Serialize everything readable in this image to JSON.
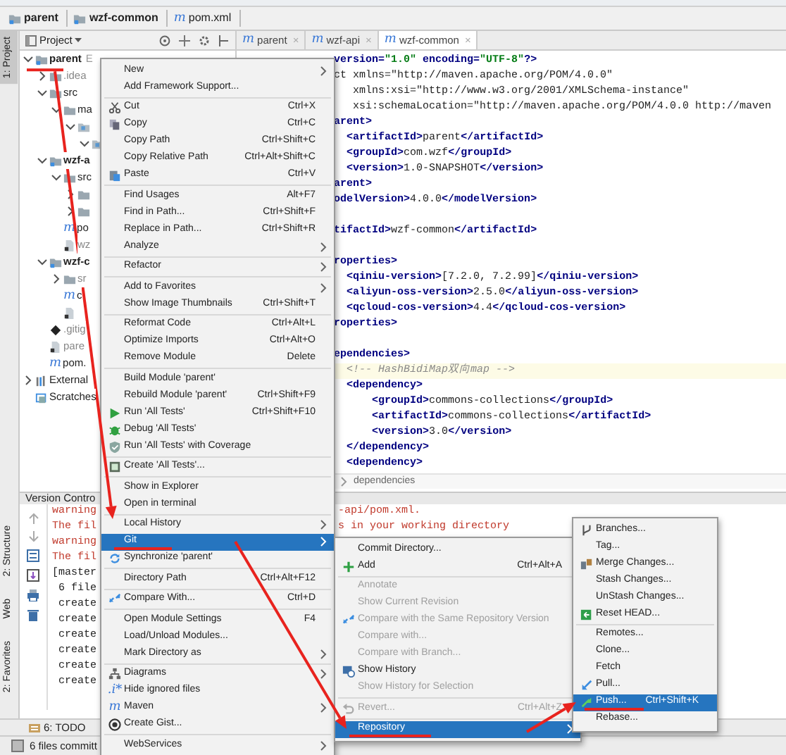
{
  "breadcrumb": [
    {
      "label": "parent",
      "kind": "module"
    },
    {
      "label": "wzf-common",
      "kind": "module"
    },
    {
      "label": "pom.xml",
      "glyph": "m"
    }
  ],
  "tool_strip": [
    {
      "label": "1: Project",
      "selected": true
    },
    {
      "label": "2: Structure",
      "selected": false
    },
    {
      "label": "Web",
      "selected": false
    },
    {
      "label": "2: Favorites",
      "selected": false
    }
  ],
  "project_panel": {
    "title": "Project",
    "tree": [
      {
        "label": "parent",
        "hint": "E",
        "kind": "module",
        "bold": true,
        "expanded": true,
        "children": [
          {
            "label": ".idea",
            "kind": "folder",
            "dim": true,
            "expanded": false
          },
          {
            "label": "src",
            "kind": "folder",
            "expanded": true,
            "children": [
              {
                "label": "ma",
                "kind": "folder",
                "expanded": true,
                "children": [
                  {
                    "kind": "package",
                    "expanded": true,
                    "children": [
                      {
                        "kind": "package",
                        "expanded": true
                      }
                    ]
                  }
                ]
              }
            ]
          },
          {
            "label": "wzf-a",
            "kind": "module",
            "bold": true,
            "expanded": true,
            "children": [
              {
                "label": "src",
                "kind": "folder",
                "expanded": true,
                "children": [
                  {
                    "kind": "folder",
                    "expanded": false
                  },
                  {
                    "kind": "folder",
                    "expanded": false
                  }
                ]
              },
              {
                "label": "po",
                "glyph": "m"
              },
              {
                "label": "wz",
                "kind": "iml",
                "dim": true
              }
            ]
          },
          {
            "label": "wzf-c",
            "kind": "module",
            "bold": true,
            "expanded": true,
            "children": [
              {
                "label": "sr",
                "kind": "folder",
                "dim": true,
                "expanded": false
              },
              {
                "label": "c",
                "glyph": "m"
              },
              {
                "kind": "iml"
              }
            ]
          },
          {
            "label": ".gitig",
            "kind": "gitignore",
            "dim": true
          },
          {
            "label": "pare",
            "kind": "iml",
            "dim": true
          },
          {
            "label": "pom.",
            "glyph": "m"
          }
        ]
      },
      {
        "label": "External",
        "kind": "library",
        "expanded": false
      },
      {
        "label": "Scratches",
        "kind": "scratch"
      }
    ]
  },
  "editor": {
    "tabs": [
      {
        "label": "parent",
        "glyph": "m",
        "close": "×",
        "selected": false
      },
      {
        "label": "wzf-api",
        "glyph": "m",
        "close": "×",
        "selected": false
      },
      {
        "label": "wzf-common",
        "glyph": "m",
        "close": "×",
        "selected": true
      }
    ],
    "lines": [
      {
        "kind": "code",
        "text": "version=\"1.0\" encoding=\"UTF-8\"?>"
      },
      {
        "kind": "code",
        "text": "ct xmlns=\"http://maven.apache.org/POM/4.0.0\""
      },
      {
        "kind": "code",
        "text": "   xmlns:xsi=\"http://www.w3.org/2001/XMLSchema-instance\""
      },
      {
        "kind": "code",
        "text": "   xsi:schemaLocation=\"http://maven.apache.org/POM/4.0.0 http://maven"
      },
      {
        "kind": "code",
        "text": "arent>"
      },
      {
        "kind": "code",
        "text": "  <artifactId>parent</artifactId>"
      },
      {
        "kind": "code",
        "text": "  <groupId>com.wzf</groupId>"
      },
      {
        "kind": "code",
        "text": "  <version>1.0-SNAPSHOT</version>"
      },
      {
        "kind": "code",
        "text": "arent>"
      },
      {
        "kind": "code",
        "text": "odelVersion>4.0.0</modelVersion>"
      },
      {
        "kind": "blank"
      },
      {
        "kind": "code",
        "text": "tifactId>wzf-common</artifactId>"
      },
      {
        "kind": "blank"
      },
      {
        "kind": "code",
        "text": "roperties>"
      },
      {
        "kind": "code",
        "text": "  <qiniu-version>[7.2.0, 7.2.99]</qiniu-version>"
      },
      {
        "kind": "code",
        "text": "  <aliyun-oss-version>2.5.0</aliyun-oss-version>"
      },
      {
        "kind": "code",
        "text": "  <qcloud-cos-version>4.4</qcloud-cos-version>"
      },
      {
        "kind": "code",
        "text": "roperties>"
      },
      {
        "kind": "blank"
      },
      {
        "kind": "code",
        "text": "ependencies>"
      },
      {
        "kind": "comment",
        "current": true,
        "text": "  <!-- HashBidiMap双向map -->"
      },
      {
        "kind": "code",
        "text": "  <dependency>"
      },
      {
        "kind": "code",
        "text": "      <groupId>commons-collections</groupId>"
      },
      {
        "kind": "code",
        "text": "      <artifactId>commons-collections</artifactId>"
      },
      {
        "kind": "code",
        "text": "      <version>3.0</version>"
      },
      {
        "kind": "code",
        "text": "  </dependency>"
      },
      {
        "kind": "code",
        "text": "  <dependency>"
      }
    ],
    "breadcrumb": "dependencies"
  },
  "version_control": {
    "title": "Version Contro",
    "lines": [
      {
        "kind": "warning",
        "left": "warning",
        "right": "-api/pom.xml."
      },
      {
        "kind": "warning",
        "left": "The fil",
        "right": "s in your working directory"
      },
      {
        "kind": "warning",
        "left": "warning"
      },
      {
        "kind": "warning",
        "left": "The fil"
      },
      {
        "kind": "normal",
        "left": "[master"
      },
      {
        "kind": "normal",
        "left": " 6 file"
      },
      {
        "kind": "normal",
        "left": " create"
      },
      {
        "kind": "normal",
        "left": " create"
      },
      {
        "kind": "normal",
        "left": " create"
      },
      {
        "kind": "normal",
        "left": " create"
      },
      {
        "kind": "normal",
        "left": " create"
      },
      {
        "kind": "normal",
        "left": " create"
      }
    ]
  },
  "bottom_tabs": [
    {
      "label": "6: TODO"
    }
  ],
  "status": "6 files committ",
  "context_menu": [
    {
      "kind": "plain",
      "label": "New",
      "submenu": true,
      "selected": false
    },
    {
      "kind": "plain",
      "label": "Add Framework Support...",
      "submenu": false,
      "selected": false
    },
    {
      "kind": "separator"
    },
    {
      "kind": "cut",
      "label": "Cut",
      "shortcut": "Ctrl+X",
      "submenu": false,
      "selected": false
    },
    {
      "kind": "copy",
      "label": "Copy",
      "shortcut": "Ctrl+C",
      "submenu": false,
      "selected": false
    },
    {
      "kind": "plain",
      "label": "Copy Path",
      "shortcut": "Ctrl+Shift+C",
      "submenu": false,
      "selected": false
    },
    {
      "kind": "plain",
      "label": "Copy Relative Path",
      "shortcut": "Ctrl+Alt+Shift+C",
      "submenu": false,
      "selected": false
    },
    {
      "kind": "paste",
      "label": "Paste",
      "shortcut": "Ctrl+V",
      "submenu": false,
      "selected": false
    },
    {
      "kind": "separator"
    },
    {
      "kind": "plain",
      "label": "Find Usages",
      "shortcut": "Alt+F7",
      "submenu": false,
      "selected": false
    },
    {
      "kind": "plain",
      "label": "Find in Path...",
      "shortcut": "Ctrl+Shift+F",
      "submenu": false,
      "selected": false
    },
    {
      "kind": "plain",
      "label": "Replace in Path...",
      "shortcut": "Ctrl+Shift+R",
      "submenu": false,
      "selected": false
    },
    {
      "kind": "plain",
      "label": "Analyze",
      "submenu": true,
      "selected": false
    },
    {
      "kind": "separator"
    },
    {
      "kind": "plain",
      "label": "Refactor",
      "submenu": true,
      "selected": false
    },
    {
      "kind": "separator"
    },
    {
      "kind": "plain",
      "label": "Add to Favorites",
      "submenu": true,
      "selected": false
    },
    {
      "kind": "plain",
      "label": "Show Image Thumbnails",
      "shortcut": "Ctrl+Shift+T",
      "submenu": false,
      "selected": false
    },
    {
      "kind": "separator"
    },
    {
      "kind": "plain",
      "label": "Reformat Code",
      "shortcut": "Ctrl+Alt+L",
      "submenu": false,
      "selected": false
    },
    {
      "kind": "plain",
      "label": "Optimize Imports",
      "shortcut": "Ctrl+Alt+O",
      "submenu": false,
      "selected": false
    },
    {
      "kind": "plain",
      "label": "Remove Module",
      "shortcut": "Delete",
      "submenu": false,
      "selected": false
    },
    {
      "kind": "separator"
    },
    {
      "kind": "plain",
      "label": "Build Module 'parent'",
      "submenu": false,
      "selected": false
    },
    {
      "kind": "plain",
      "label": "Rebuild Module 'parent'",
      "shortcut": "Ctrl+Shift+F9",
      "submenu": false,
      "selected": false
    },
    {
      "kind": "run",
      "label": "Run 'All Tests'",
      "shortcut": "Ctrl+Shift+F10",
      "submenu": false,
      "selected": false
    },
    {
      "kind": "debug",
      "label": "Debug 'All Tests'",
      "submenu": false,
      "selected": false
    },
    {
      "kind": "coverage",
      "label": "Run 'All Tests' with Coverage",
      "submenu": false,
      "selected": false
    },
    {
      "kind": "separator"
    },
    {
      "kind": "test",
      "label": "Create 'All Tests'...",
      "submenu": false,
      "selected": false
    },
    {
      "kind": "separator"
    },
    {
      "kind": "plain",
      "label": "Show in Explorer",
      "submenu": false,
      "selected": false
    },
    {
      "kind": "plain",
      "label": "Open in terminal",
      "submenu": false,
      "selected": false
    },
    {
      "kind": "separator"
    },
    {
      "kind": "plain",
      "label": "Local History",
      "submenu": true,
      "selected": false
    },
    {
      "kind": "plain",
      "label": "Git",
      "submenu": true,
      "selected": true
    },
    {
      "kind": "sync",
      "label": "Synchronize 'parent'",
      "submenu": false,
      "selected": false
    },
    {
      "kind": "separator"
    },
    {
      "kind": "plain",
      "label": "Directory Path",
      "shortcut": "Ctrl+Alt+F12",
      "submenu": false,
      "selected": false
    },
    {
      "kind": "separator"
    },
    {
      "kind": "compare",
      "label": "Compare With...",
      "shortcut": "Ctrl+D",
      "submenu": false,
      "selected": false
    },
    {
      "kind": "separator"
    },
    {
      "kind": "plain",
      "label": "Open Module Settings",
      "shortcut": "F4",
      "submenu": false,
      "selected": false
    },
    {
      "kind": "plain",
      "label": "Load/Unload Modules...",
      "submenu": false,
      "selected": false
    },
    {
      "kind": "plain",
      "label": "Mark Directory as",
      "submenu": true,
      "selected": false
    },
    {
      "kind": "separator"
    },
    {
      "kind": "diagram",
      "label": "Diagrams",
      "submenu": true,
      "selected": false
    },
    {
      "kind": "plain",
      "label": "Hide ignored files",
      "glyph": ".i*",
      "submenu": false,
      "selected": false
    },
    {
      "kind": "plain",
      "label": "Maven",
      "glyph": "m",
      "submenu": true,
      "selected": false
    },
    {
      "kind": "gist",
      "label": "Create Gist...",
      "submenu": false,
      "selected": false
    },
    {
      "kind": "separator"
    },
    {
      "kind": "plain",
      "label": "WebServices",
      "submenu": true,
      "selected": false
    }
  ],
  "git_menu": [
    {
      "kind": "plain",
      "label": "Commit Directory...",
      "disabled": false,
      "submenu": false,
      "selected": false
    },
    {
      "kind": "add",
      "label": "Add",
      "shortcut": "Ctrl+Alt+A",
      "disabled": false,
      "submenu": false,
      "selected": false
    },
    {
      "kind": "separator"
    },
    {
      "kind": "plain",
      "label": "Annotate",
      "disabled": true,
      "submenu": false,
      "selected": false
    },
    {
      "kind": "plain",
      "label": "Show Current Revision",
      "disabled": true,
      "submenu": false,
      "selected": false
    },
    {
      "kind": "compare",
      "label": "Compare with the Same Repository Version",
      "disabled": true,
      "submenu": false,
      "selected": false
    },
    {
      "kind": "plain",
      "label": "Compare with...",
      "disabled": true,
      "submenu": false,
      "selected": false
    },
    {
      "kind": "plain",
      "label": "Compare with Branch...",
      "disabled": true,
      "submenu": false,
      "selected": false
    },
    {
      "kind": "history",
      "label": "Show History",
      "disabled": false,
      "submenu": false,
      "selected": false
    },
    {
      "kind": "plain",
      "label": "Show History for Selection",
      "disabled": true,
      "submenu": false,
      "selected": false
    },
    {
      "kind": "separator"
    },
    {
      "kind": "revert",
      "label": "Revert...",
      "shortcut": "Ctrl+Alt+Z",
      "disabled": true,
      "submenu": false,
      "selected": false
    },
    {
      "kind": "separator"
    },
    {
      "kind": "plain",
      "label": "Repository",
      "disabled": false,
      "submenu": true,
      "selected": true
    }
  ],
  "repository_menu": [
    {
      "kind": "branch",
      "label": "Branches...",
      "submenu": false,
      "selected": false
    },
    {
      "kind": "plain",
      "label": "Tag...",
      "submenu": false,
      "selected": false
    },
    {
      "kind": "merge",
      "label": "Merge Changes...",
      "submenu": false,
      "selected": false
    },
    {
      "kind": "plain",
      "label": "Stash Changes...",
      "submenu": false,
      "selected": false
    },
    {
      "kind": "plain",
      "label": "UnStash Changes...",
      "submenu": false,
      "selected": false
    },
    {
      "kind": "reset",
      "label": "Reset HEAD...",
      "submenu": false,
      "selected": false
    },
    {
      "kind": "separator"
    },
    {
      "kind": "plain",
      "label": "Remotes...",
      "submenu": false,
      "selected": false
    },
    {
      "kind": "plain",
      "label": "Clone...",
      "submenu": false,
      "selected": false
    },
    {
      "kind": "plain",
      "label": "Fetch",
      "submenu": false,
      "selected": false
    },
    {
      "kind": "pull",
      "label": "Pull...",
      "submenu": false,
      "selected": false
    },
    {
      "kind": "push",
      "label": "Push...",
      "shortcut": "Ctrl+Shift+K",
      "submenu": false,
      "selected": true
    },
    {
      "kind": "plain",
      "label": "Rebase...",
      "submenu": false,
      "selected": false
    }
  ]
}
